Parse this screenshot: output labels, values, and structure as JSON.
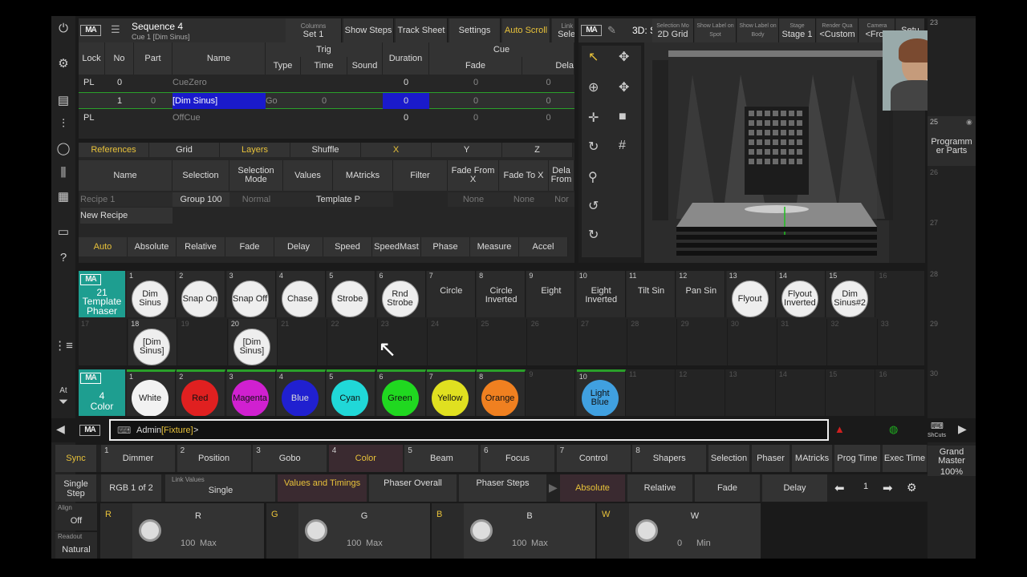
{
  "sequence": {
    "title": "Sequence 4",
    "subtitle": "Cue 1 [Dim Sinus]",
    "menu_icon": "hamburger-icon"
  },
  "seq_header_buttons": [
    {
      "small": "Columns",
      "label": "Set 1"
    },
    {
      "small": "",
      "label": "Show Steps"
    },
    {
      "small": "",
      "label": "Track Sheet"
    },
    {
      "small": "",
      "label": "Settings"
    },
    {
      "small": "",
      "label": "Auto Scroll"
    },
    {
      "small": "Link Type",
      "label": "Selected"
    }
  ],
  "seq_columns": {
    "lock": "Lock",
    "no": "No",
    "part": "Part",
    "name": "Name",
    "trig": "Trig",
    "type": "Type",
    "time": "Time",
    "sound": "Sound",
    "duration": "Duration",
    "cue": "Cue",
    "fade": "Fade",
    "delay": "Dela"
  },
  "seq_rows": [
    {
      "lock": "PL",
      "no": "0",
      "part": "",
      "name": "CueZero",
      "type": "",
      "time": "",
      "duration": "0",
      "fade": "0",
      "delay": "0"
    },
    {
      "lock": "",
      "no": "1",
      "part": "0",
      "name": "[Dim  Sinus]",
      "type": "Go",
      "time": "0",
      "duration": "0",
      "fade": "0",
      "delay": "0"
    },
    {
      "lock": "PL",
      "no": "",
      "part": "",
      "name": "OffCue",
      "type": "",
      "time": "",
      "duration": "0",
      "fade": "0",
      "delay": "0"
    }
  ],
  "phaser_tabs": [
    "References",
    "Grid",
    "Layers",
    "Shuffle",
    "X",
    "Y",
    "Z"
  ],
  "phaser_cols": [
    "Name",
    "Selection",
    "Selection Mode",
    "Values",
    "MAtricks",
    "Filter",
    "Fade From X",
    "Fade To X",
    "Dela From"
  ],
  "recipe_rows": [
    {
      "name": "Recipe 1",
      "selection": "Group 100",
      "mode": "Normal",
      "values": "Template P",
      "fade_from": "None",
      "fade_to": "None",
      "delay": "Nor"
    }
  ],
  "new_recipe": "New Recipe",
  "phaser_bottom": [
    "Auto",
    "Absolute",
    "Relative",
    "Fade",
    "Delay",
    "Speed",
    "SpeedMast",
    "Phase",
    "Measure",
    "Accel"
  ],
  "viewer": {
    "title": "3D: S",
    "buttons": [
      {
        "small": "Selection Mo",
        "label": "2D Grid"
      },
      {
        "small": "Show Label on Spot",
        "label": ""
      },
      {
        "small": "Show Label on Body",
        "label": ""
      },
      {
        "small": "Stage",
        "label": "Stage 1"
      },
      {
        "small": "Render Qua",
        "label": "<Custom"
      },
      {
        "small": "Camera",
        "label": "<Fron"
      },
      {
        "small": "",
        "label": "Setu"
      }
    ]
  },
  "right_column": {
    "n23": "23",
    "n25": "25",
    "prog_parts": "Programm er Parts",
    "n26": "26",
    "n27": "27",
    "n28": "28",
    "n29": "29",
    "n30": "30",
    "grand_master": "Grand Master",
    "gm_value": "100%"
  },
  "phaser_pool": {
    "tile_num": "21",
    "label": "Template Phaser",
    "items": [
      {
        "n": "1",
        "name": "Dim Sinus",
        "style": "white"
      },
      {
        "n": "2",
        "name": "Snap On",
        "style": "white"
      },
      {
        "n": "3",
        "name": "Snap Off",
        "style": "white"
      },
      {
        "n": "4",
        "name": "Chase",
        "style": "white"
      },
      {
        "n": "5",
        "name": "Strobe",
        "style": "white"
      },
      {
        "n": "6",
        "name": "Rnd Strobe",
        "style": "white"
      },
      {
        "n": "7",
        "name": "Circle",
        "style": "plain"
      },
      {
        "n": "8",
        "name": "Circle Inverted",
        "style": "plain"
      },
      {
        "n": "9",
        "name": "Eight",
        "style": "plain"
      },
      {
        "n": "10",
        "name": "Eight Inverted",
        "style": "plain"
      },
      {
        "n": "11",
        "name": "Tilt Sin",
        "style": "plain"
      },
      {
        "n": "12",
        "name": "Pan Sin",
        "style": "plain"
      },
      {
        "n": "13",
        "name": "Flyout",
        "style": "white"
      },
      {
        "n": "14",
        "name": "Flyout Inverted",
        "style": "white"
      },
      {
        "n": "15",
        "name": "Dim Sinus#2",
        "style": "white"
      },
      {
        "n": "16",
        "name": "",
        "style": "empty"
      }
    ],
    "row2": [
      {
        "n": "17",
        "name": "",
        "style": "empty"
      },
      {
        "n": "18",
        "name": "[Dim Sinus]",
        "style": "white"
      },
      {
        "n": "19",
        "name": "",
        "style": "empty"
      },
      {
        "n": "20",
        "name": "[Dim Sinus]",
        "style": "white"
      },
      {
        "n": "21",
        "name": "",
        "style": "empty"
      },
      {
        "n": "22",
        "name": "",
        "style": "empty"
      },
      {
        "n": "23",
        "name": "",
        "style": "empty"
      },
      {
        "n": "24",
        "name": "",
        "style": "empty"
      },
      {
        "n": "25",
        "name": "",
        "style": "empty"
      },
      {
        "n": "26",
        "name": "",
        "style": "empty"
      },
      {
        "n": "27",
        "name": "",
        "style": "empty"
      },
      {
        "n": "28",
        "name": "",
        "style": "empty"
      },
      {
        "n": "29",
        "name": "",
        "style": "empty"
      },
      {
        "n": "30",
        "name": "",
        "style": "empty"
      },
      {
        "n": "31",
        "name": "",
        "style": "empty"
      },
      {
        "n": "32",
        "name": "",
        "style": "empty"
      },
      {
        "n": "33",
        "name": "",
        "style": "empty"
      }
    ]
  },
  "color_pool": {
    "tile_num": "4",
    "label": "Color",
    "items": [
      {
        "n": "1",
        "name": "White",
        "color": "#f2f2f2",
        "text": "#222"
      },
      {
        "n": "2",
        "name": "Red",
        "color": "#e02020",
        "text": "#111"
      },
      {
        "n": "3",
        "name": "Magenta",
        "color": "#d020d0",
        "text": "#111"
      },
      {
        "n": "4",
        "name": "Blue",
        "color": "#2020d0",
        "text": "#ddd"
      },
      {
        "n": "5",
        "name": "Cyan",
        "color": "#20d8d8",
        "text": "#111"
      },
      {
        "n": "6",
        "name": "Green",
        "color": "#20d820",
        "text": "#111"
      },
      {
        "n": "7",
        "name": "Yellow",
        "color": "#e0e020",
        "text": "#111"
      },
      {
        "n": "8",
        "name": "Orange",
        "color": "#f08020",
        "text": "#111"
      },
      {
        "n": "9",
        "name": "",
        "color": "",
        "text": ""
      },
      {
        "n": "10",
        "name": "Light Blue",
        "color": "#40a0e0",
        "text": "#111"
      },
      {
        "n": "11",
        "name": "",
        "color": "",
        "text": ""
      },
      {
        "n": "12",
        "name": "",
        "color": "",
        "text": ""
      },
      {
        "n": "13",
        "name": "",
        "color": "",
        "text": ""
      },
      {
        "n": "14",
        "name": "",
        "color": "",
        "text": ""
      },
      {
        "n": "15",
        "name": "",
        "color": "",
        "text": ""
      },
      {
        "n": "16",
        "name": "",
        "color": "",
        "text": ""
      }
    ]
  },
  "command_line": {
    "prefix": "Admin",
    "fixture": "[Fixture]",
    "suffix": ">",
    "shcuts": "ShCuts"
  },
  "presets": {
    "sync": "Sync",
    "items": [
      {
        "n": "1",
        "label": "Dimmer"
      },
      {
        "n": "2",
        "label": "Position"
      },
      {
        "n": "3",
        "label": "Gobo"
      },
      {
        "n": "4",
        "label": "Color"
      },
      {
        "n": "5",
        "label": "Beam"
      },
      {
        "n": "6",
        "label": "Focus"
      },
      {
        "n": "7",
        "label": "Control"
      },
      {
        "n": "8",
        "label": "Shapers"
      }
    ],
    "right": [
      "Selection",
      "Phaser",
      "MAtricks",
      "Prog Time",
      "Exec Time"
    ]
  },
  "row2": {
    "single_step": "Single Step",
    "rgb": "RGB 1 of 2",
    "link_values_small": "Link Values",
    "link_values": "Single",
    "values_timings": "Values and Timings",
    "phaser_overall": "Phaser Overall",
    "phaser_steps": "Phaser Steps",
    "absolute": "Absolute",
    "relative": "Relative",
    "fade": "Fade",
    "delay": "Delay",
    "page": "1"
  },
  "left_stack": {
    "align_small": "Align",
    "align": "Off",
    "readout_small": "Readout",
    "readout": "Natural"
  },
  "encoders": [
    {
      "tag": "R",
      "name": "R",
      "value": "100",
      "mode": "Max"
    },
    {
      "tag": "G",
      "name": "G",
      "value": "100",
      "mode": "Max"
    },
    {
      "tag": "B",
      "name": "B",
      "value": "100",
      "mode": "Max"
    },
    {
      "tag": "W",
      "name": "W",
      "value": "0",
      "mode": "Min"
    }
  ],
  "colors": {
    "accent": "#e8c23a",
    "teal": "#1e9e90",
    "select_blue": "#1a1acc",
    "green_bar": "#2aa02a"
  }
}
